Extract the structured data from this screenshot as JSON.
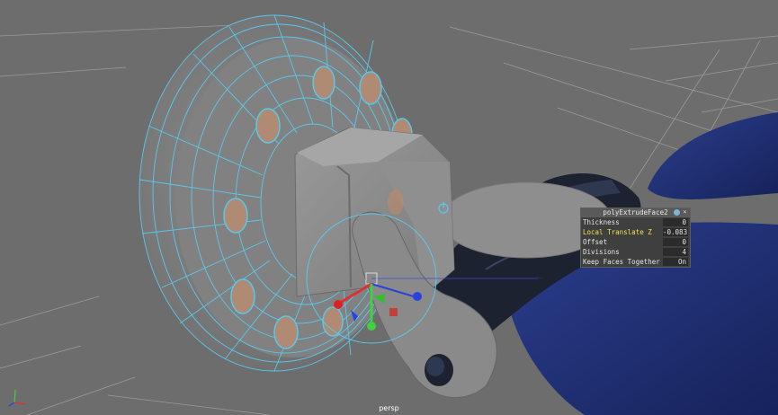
{
  "viewport": {
    "camera_label": "persp",
    "colors": {
      "background": "#6d6d6d",
      "wireframe": "#59c8ec",
      "grid": "#9a9a9a",
      "tread": "#1c2230",
      "body_blue": "#1f2f78"
    }
  },
  "hud": {
    "title": "polyExtrudeFace2",
    "icons": [
      "info-icon",
      "close-icon"
    ],
    "close_glyph": "×",
    "rows": [
      {
        "label": "Thickness",
        "value": "0",
        "highlighted": false
      },
      {
        "label": "Local Translate Z",
        "value": "-0.083",
        "highlighted": true
      },
      {
        "label": "Offset",
        "value": "0",
        "highlighted": false
      },
      {
        "label": "Divisions",
        "value": "4",
        "highlighted": false
      },
      {
        "label": "Keep Faces Together",
        "value": "On",
        "highlighted": false
      }
    ]
  },
  "axis_indicator": {
    "x_label": "",
    "y_label": "",
    "z_label": ""
  }
}
